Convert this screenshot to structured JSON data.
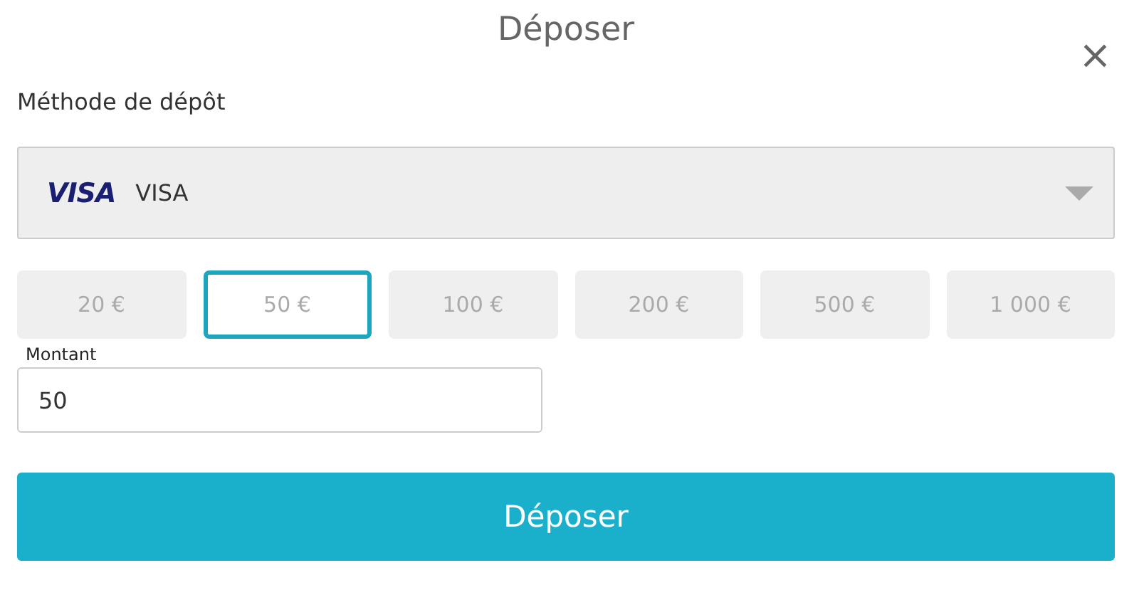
{
  "dialog": {
    "title": "Déposer",
    "close": "×"
  },
  "method": {
    "label": "Méthode de dépôt",
    "logo_text": "VISA",
    "value": "VISA"
  },
  "amounts": [
    {
      "label": "20 €",
      "selected": false
    },
    {
      "label": "50 €",
      "selected": true
    },
    {
      "label": "100 €",
      "selected": false
    },
    {
      "label": "200 €",
      "selected": false
    },
    {
      "label": "500 €",
      "selected": false
    },
    {
      "label": "1 000 €",
      "selected": false
    }
  ],
  "amount_field": {
    "label": "Montant",
    "value": "50"
  },
  "submit": "Déposer"
}
